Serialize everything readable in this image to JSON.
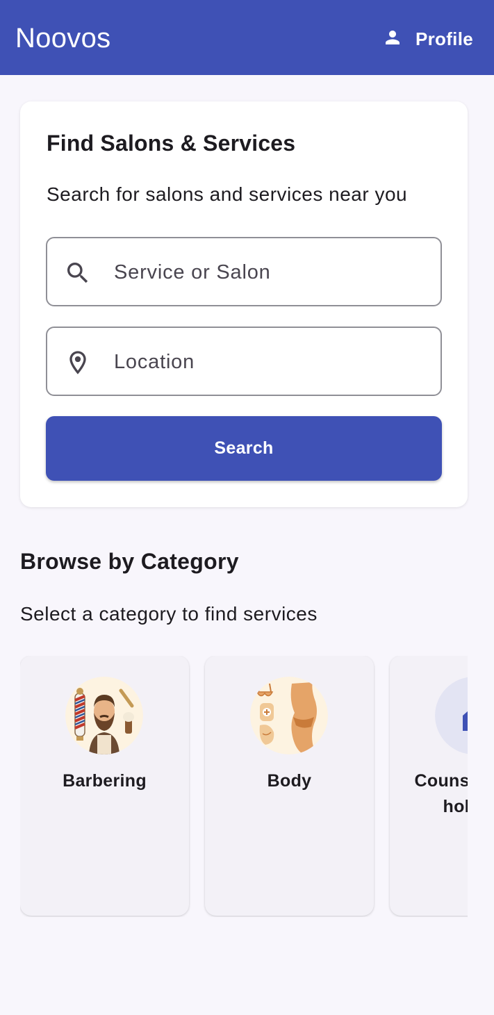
{
  "appbar": {
    "title": "Noovos",
    "profile_label": "Profile",
    "profile_icon": "person-icon",
    "color": "#3f51b5"
  },
  "search_card": {
    "title": "Find Salons & Services",
    "subtitle": "Search for salons and services near you",
    "service_field": {
      "placeholder": "Service or Salon",
      "value": "",
      "icon": "search-icon"
    },
    "location_field": {
      "placeholder": "Location",
      "value": "",
      "icon": "location-pin-icon"
    },
    "search_button_label": "Search"
  },
  "categories": {
    "title": "Browse by Category",
    "subtitle": "Select a category to find services",
    "items": [
      {
        "label": "Barbering",
        "icon": "barber-illustration"
      },
      {
        "label": "Body",
        "icon": "body-illustration"
      },
      {
        "label": "Counselling & holistic",
        "icon": "category-icon"
      }
    ]
  }
}
